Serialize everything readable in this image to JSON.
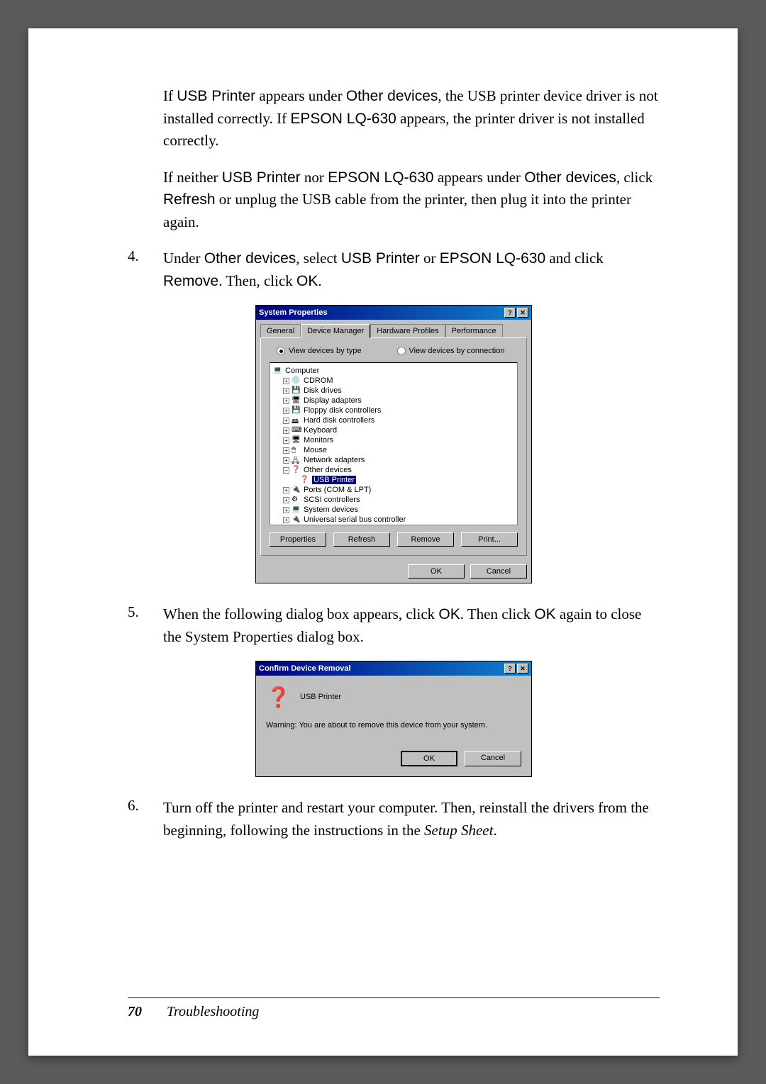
{
  "paragraphs": {
    "p1_a": "If ",
    "p1_usb": "USB Printer",
    "p1_b": " appears under ",
    "p1_other": "Other devices",
    "p1_c": ", the USB printer device driver is not installed correctly. If ",
    "p1_epson": "EPSON LQ-630",
    "p1_d": " appears, the printer driver is not installed correctly.",
    "p2_a": "If neither ",
    "p2_usb": "USB Printer",
    "p2_b": " nor ",
    "p2_epson": "EPSON LQ-630",
    "p2_c": " appears under ",
    "p2_other": "Other devices",
    "p2_d": ", click ",
    "p2_refresh": "Refresh",
    "p2_e": " or unplug the USB cable from the printer, then plug it into the printer again."
  },
  "steps": {
    "s4_num": "4.",
    "s4_a": "Under ",
    "s4_other": "Other devices",
    "s4_b": ", select ",
    "s4_usb": "USB Printer",
    "s4_c": " or ",
    "s4_epson": "EPSON LQ-630",
    "s4_d": " and click ",
    "s4_remove": "Remove",
    "s4_e": ". Then, click ",
    "s4_ok": "OK",
    "s4_f": ".",
    "s5_num": "5.",
    "s5_a": "When the following dialog box appears, click ",
    "s5_ok": "OK",
    "s5_b": ". Then click ",
    "s5_ok2": "OK",
    "s5_c": " again to close the System Properties dialog box.",
    "s6_num": "6.",
    "s6_text": "Turn off the printer and restart your computer. Then, reinstall the drivers from the beginning, following the instructions in the ",
    "s6_setup": "Setup Sheet",
    "s6_end": "."
  },
  "dialog1": {
    "title": "System Properties",
    "help": "?",
    "close": "✕",
    "tabs": {
      "general": "General",
      "device_manager": "Device Manager",
      "hardware": "Hardware Profiles",
      "performance": "Performance"
    },
    "radio_type": "View devices by type",
    "radio_conn": "View devices by connection",
    "tree": {
      "computer": "Computer",
      "cdrom": "CDROM",
      "disk": "Disk drives",
      "display": "Display adapters",
      "floppy": "Floppy disk controllers",
      "hdd": "Hard disk controllers",
      "keyboard": "Keyboard",
      "monitors": "Monitors",
      "mouse": "Mouse",
      "network": "Network adapters",
      "other": "Other devices",
      "usb_printer": "USB Printer",
      "ports": "Ports (COM & LPT)",
      "scsi": "SCSI controllers",
      "system": "System devices",
      "usb_ctrl": "Universal serial bus controller"
    },
    "buttons": {
      "properties": "Properties",
      "refresh": "Refresh",
      "remove": "Remove",
      "print": "Print...",
      "ok": "OK",
      "cancel": "Cancel"
    }
  },
  "dialog2": {
    "title": "Confirm Device Removal",
    "help": "?",
    "close": "✕",
    "device": "USB Printer",
    "warning": "Warning: You are about to remove this device from your system.",
    "ok": "OK",
    "cancel": "Cancel"
  },
  "footer": {
    "page": "70",
    "section": "Troubleshooting"
  }
}
